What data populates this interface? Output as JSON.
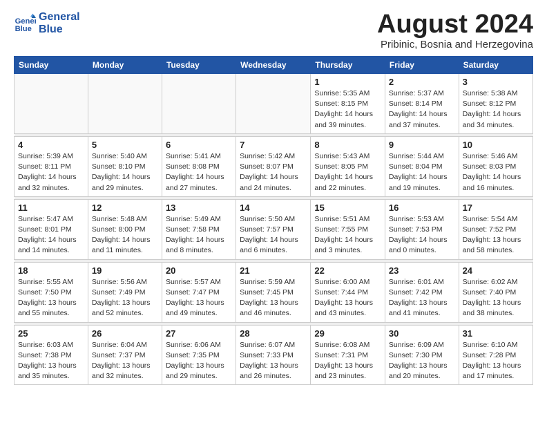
{
  "header": {
    "logo_line1": "General",
    "logo_line2": "Blue",
    "month_year": "August 2024",
    "location": "Pribinic, Bosnia and Herzegovina"
  },
  "weekdays": [
    "Sunday",
    "Monday",
    "Tuesday",
    "Wednesday",
    "Thursday",
    "Friday",
    "Saturday"
  ],
  "weeks": [
    [
      {
        "day": "",
        "info": ""
      },
      {
        "day": "",
        "info": ""
      },
      {
        "day": "",
        "info": ""
      },
      {
        "day": "",
        "info": ""
      },
      {
        "day": "1",
        "info": "Sunrise: 5:35 AM\nSunset: 8:15 PM\nDaylight: 14 hours\nand 39 minutes."
      },
      {
        "day": "2",
        "info": "Sunrise: 5:37 AM\nSunset: 8:14 PM\nDaylight: 14 hours\nand 37 minutes."
      },
      {
        "day": "3",
        "info": "Sunrise: 5:38 AM\nSunset: 8:12 PM\nDaylight: 14 hours\nand 34 minutes."
      }
    ],
    [
      {
        "day": "4",
        "info": "Sunrise: 5:39 AM\nSunset: 8:11 PM\nDaylight: 14 hours\nand 32 minutes."
      },
      {
        "day": "5",
        "info": "Sunrise: 5:40 AM\nSunset: 8:10 PM\nDaylight: 14 hours\nand 29 minutes."
      },
      {
        "day": "6",
        "info": "Sunrise: 5:41 AM\nSunset: 8:08 PM\nDaylight: 14 hours\nand 27 minutes."
      },
      {
        "day": "7",
        "info": "Sunrise: 5:42 AM\nSunset: 8:07 PM\nDaylight: 14 hours\nand 24 minutes."
      },
      {
        "day": "8",
        "info": "Sunrise: 5:43 AM\nSunset: 8:05 PM\nDaylight: 14 hours\nand 22 minutes."
      },
      {
        "day": "9",
        "info": "Sunrise: 5:44 AM\nSunset: 8:04 PM\nDaylight: 14 hours\nand 19 minutes."
      },
      {
        "day": "10",
        "info": "Sunrise: 5:46 AM\nSunset: 8:03 PM\nDaylight: 14 hours\nand 16 minutes."
      }
    ],
    [
      {
        "day": "11",
        "info": "Sunrise: 5:47 AM\nSunset: 8:01 PM\nDaylight: 14 hours\nand 14 minutes."
      },
      {
        "day": "12",
        "info": "Sunrise: 5:48 AM\nSunset: 8:00 PM\nDaylight: 14 hours\nand 11 minutes."
      },
      {
        "day": "13",
        "info": "Sunrise: 5:49 AM\nSunset: 7:58 PM\nDaylight: 14 hours\nand 8 minutes."
      },
      {
        "day": "14",
        "info": "Sunrise: 5:50 AM\nSunset: 7:57 PM\nDaylight: 14 hours\nand 6 minutes."
      },
      {
        "day": "15",
        "info": "Sunrise: 5:51 AM\nSunset: 7:55 PM\nDaylight: 14 hours\nand 3 minutes."
      },
      {
        "day": "16",
        "info": "Sunrise: 5:53 AM\nSunset: 7:53 PM\nDaylight: 14 hours\nand 0 minutes."
      },
      {
        "day": "17",
        "info": "Sunrise: 5:54 AM\nSunset: 7:52 PM\nDaylight: 13 hours\nand 58 minutes."
      }
    ],
    [
      {
        "day": "18",
        "info": "Sunrise: 5:55 AM\nSunset: 7:50 PM\nDaylight: 13 hours\nand 55 minutes."
      },
      {
        "day": "19",
        "info": "Sunrise: 5:56 AM\nSunset: 7:49 PM\nDaylight: 13 hours\nand 52 minutes."
      },
      {
        "day": "20",
        "info": "Sunrise: 5:57 AM\nSunset: 7:47 PM\nDaylight: 13 hours\nand 49 minutes."
      },
      {
        "day": "21",
        "info": "Sunrise: 5:59 AM\nSunset: 7:45 PM\nDaylight: 13 hours\nand 46 minutes."
      },
      {
        "day": "22",
        "info": "Sunrise: 6:00 AM\nSunset: 7:44 PM\nDaylight: 13 hours\nand 43 minutes."
      },
      {
        "day": "23",
        "info": "Sunrise: 6:01 AM\nSunset: 7:42 PM\nDaylight: 13 hours\nand 41 minutes."
      },
      {
        "day": "24",
        "info": "Sunrise: 6:02 AM\nSunset: 7:40 PM\nDaylight: 13 hours\nand 38 minutes."
      }
    ],
    [
      {
        "day": "25",
        "info": "Sunrise: 6:03 AM\nSunset: 7:38 PM\nDaylight: 13 hours\nand 35 minutes."
      },
      {
        "day": "26",
        "info": "Sunrise: 6:04 AM\nSunset: 7:37 PM\nDaylight: 13 hours\nand 32 minutes."
      },
      {
        "day": "27",
        "info": "Sunrise: 6:06 AM\nSunset: 7:35 PM\nDaylight: 13 hours\nand 29 minutes."
      },
      {
        "day": "28",
        "info": "Sunrise: 6:07 AM\nSunset: 7:33 PM\nDaylight: 13 hours\nand 26 minutes."
      },
      {
        "day": "29",
        "info": "Sunrise: 6:08 AM\nSunset: 7:31 PM\nDaylight: 13 hours\nand 23 minutes."
      },
      {
        "day": "30",
        "info": "Sunrise: 6:09 AM\nSunset: 7:30 PM\nDaylight: 13 hours\nand 20 minutes."
      },
      {
        "day": "31",
        "info": "Sunrise: 6:10 AM\nSunset: 7:28 PM\nDaylight: 13 hours\nand 17 minutes."
      }
    ]
  ]
}
